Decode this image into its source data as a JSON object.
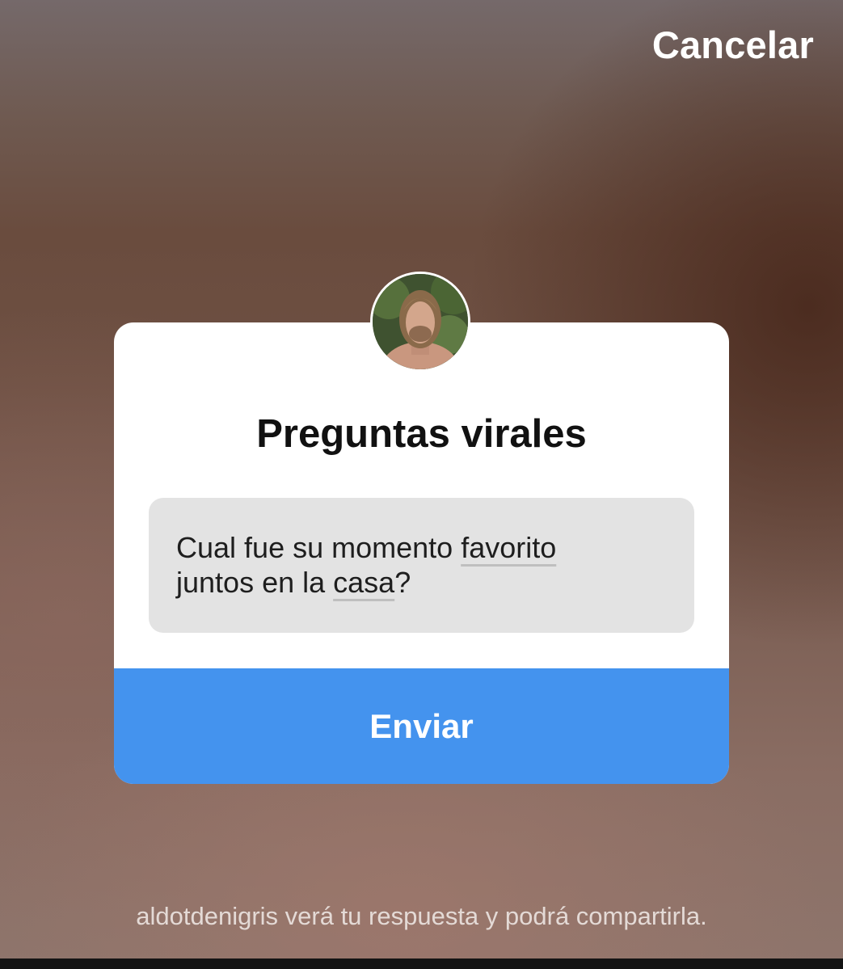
{
  "header": {
    "cancel_label": "Cancelar"
  },
  "card": {
    "avatar_icon": "profile-photo",
    "title": "Preguntas virales",
    "answer": {
      "segments": [
        "Cual fue su momento ",
        "favorito",
        "juntos en la ",
        "casa",
        "?"
      ]
    },
    "send_label": "Enviar"
  },
  "footer": {
    "note": "aldotdenigris verá tu respuesta y podrá compartirla."
  },
  "colors": {
    "accent": "#4493ee",
    "card_bg": "#ffffff",
    "input_bg": "#e3e3e3"
  }
}
